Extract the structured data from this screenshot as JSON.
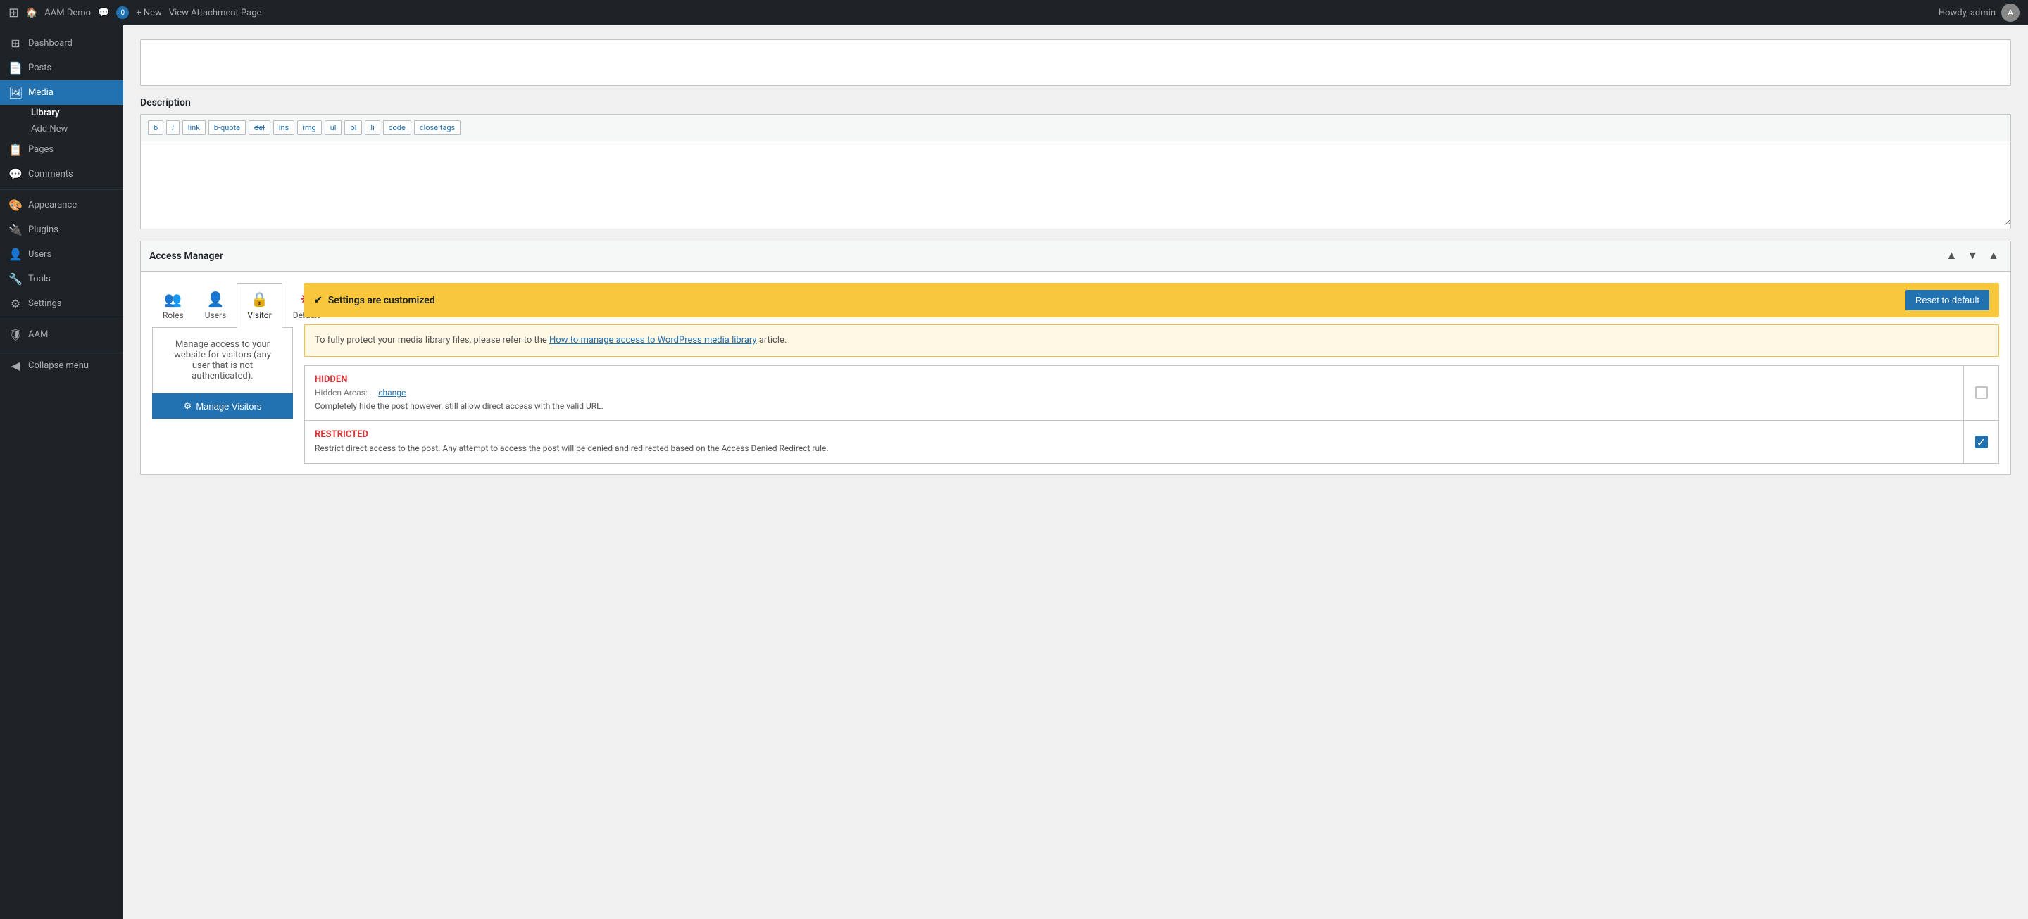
{
  "topbar": {
    "wp_icon": "⚙",
    "site_name": "AAM Demo",
    "comment_count": "0",
    "new_label": "+ New",
    "view_attachment": "View Attachment Page",
    "howdy": "Howdy, admin"
  },
  "sidebar": {
    "items": [
      {
        "id": "dashboard",
        "icon": "⊞",
        "label": "Dashboard"
      },
      {
        "id": "posts",
        "icon": "📄",
        "label": "Posts"
      },
      {
        "id": "media",
        "icon": "🖼",
        "label": "Media",
        "active": true,
        "subs": [
          {
            "id": "library",
            "label": "Library",
            "active": true
          },
          {
            "id": "add-new",
            "label": "Add New"
          }
        ]
      },
      {
        "id": "pages",
        "icon": "📋",
        "label": "Pages"
      },
      {
        "id": "comments",
        "icon": "💬",
        "label": "Comments"
      },
      {
        "id": "appearance",
        "icon": "🎨",
        "label": "Appearance"
      },
      {
        "id": "plugins",
        "icon": "🔌",
        "label": "Plugins"
      },
      {
        "id": "users",
        "icon": "👤",
        "label": "Users"
      },
      {
        "id": "tools",
        "icon": "🔧",
        "label": "Tools"
      },
      {
        "id": "settings",
        "icon": "⚙",
        "label": "Settings"
      },
      {
        "id": "aam",
        "icon": "🛡",
        "label": "AAM"
      }
    ],
    "collapse_label": "Collapse menu"
  },
  "editor": {
    "description_label": "Description",
    "toolbar_buttons": [
      "b",
      "i",
      "link",
      "b-quote",
      "del",
      "ins",
      "img",
      "ul",
      "ol",
      "li",
      "code",
      "close tags"
    ]
  },
  "access_manager": {
    "title": "Access Manager",
    "tabs": [
      {
        "id": "roles",
        "icon": "👥",
        "label": "Roles",
        "color": "blue"
      },
      {
        "id": "users",
        "icon": "👤",
        "label": "Users",
        "color": "blue"
      },
      {
        "id": "visitor",
        "icon": "🔒",
        "label": "Visitor",
        "color": "default",
        "active": true
      },
      {
        "id": "default",
        "icon": "❋",
        "label": "Default",
        "color": "red"
      }
    ],
    "visitor_info": "Manage access to your website for visitors (any user that is not authenticated).",
    "manage_visitors_btn": "Manage Visitors",
    "customized_banner": {
      "icon": "✔",
      "text": "Settings are customized",
      "reset_btn": "Reset to default"
    },
    "info_notice": {
      "text_before": "To fully protect your media library files, please refer to the ",
      "link_text": "How to manage access to WordPress media library",
      "text_after": " article."
    },
    "permissions": [
      {
        "id": "hidden",
        "title": "HIDDEN",
        "meta_label": "Hidden Areas: ...",
        "meta_link": "change",
        "description": "Completely hide the post however, still allow direct access with the valid URL.",
        "checked": false
      },
      {
        "id": "restricted",
        "title": "RESTRICTED",
        "description": "Restrict direct access to the post. Any attempt to access the post will be denied and redirected based on the Access Denied Redirect rule.",
        "checked": true
      }
    ]
  }
}
